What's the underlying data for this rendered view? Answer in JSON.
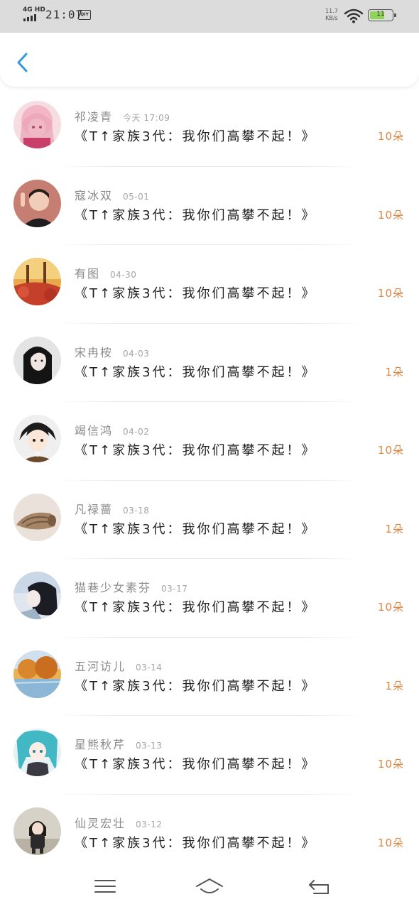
{
  "status_bar": {
    "network": "4G HD",
    "time": "21:07",
    "app_icon_label": "QIY",
    "speed_value": "11.7",
    "speed_unit": "KB/s",
    "battery_label": "11"
  },
  "header": {
    "back_icon": "chevron-left-icon",
    "accent_color": "#2f9be0"
  },
  "list": {
    "count_color": "#e0853e",
    "items": [
      {
        "name": "祁凌青",
        "date": "今天 17:09",
        "title": "《T↑家族3代：我你们高攀不起！》",
        "count": "10朵",
        "avatar": "pink-hair-anime-girl"
      },
      {
        "name": "寇冰双",
        "date": "05-01",
        "title": "《T↑家族3代：我你们高攀不起！》",
        "count": "10朵",
        "avatar": "boy-portrait"
      },
      {
        "name": "有图",
        "date": "04-30",
        "title": "《T↑家族3代：我你们高攀不起！》",
        "count": "10朵",
        "avatar": "autumn-forest"
      },
      {
        "name": "宋冉桉",
        "date": "04-03",
        "title": "《T↑家族3代：我你们高攀不起！》",
        "count": "1朵",
        "avatar": "dark-hair-girl"
      },
      {
        "name": "竭信鸿",
        "date": "04-02",
        "title": "《T↑家族3代：我你们高攀不起！》",
        "count": "10朵",
        "avatar": "anime-boy"
      },
      {
        "name": "凡禄蔷",
        "date": "03-18",
        "title": "《T↑家族3代：我你们高攀不起！》",
        "count": "1朵",
        "avatar": "seashell"
      },
      {
        "name": "猫巷少女素芬",
        "date": "03-17",
        "title": "《T↑家族3代：我你们高攀不起！》",
        "count": "10朵",
        "avatar": "girl-profile"
      },
      {
        "name": "五河访儿",
        "date": "03-14",
        "title": "《T↑家族3代：我你们高攀不起！》",
        "count": "1朵",
        "avatar": "autumn-lake"
      },
      {
        "name": "星熊秋芹",
        "date": "03-13",
        "title": "《T↑家族3代：我你们高攀不起！》",
        "count": "10朵",
        "avatar": "teal-hair-anime"
      },
      {
        "name": "仙灵宏壮",
        "date": "03-12",
        "title": "《T↑家族3代：我你们高攀不起！》",
        "count": "10朵",
        "avatar": "child-photo"
      }
    ]
  },
  "bottom_nav": {
    "items": [
      "menu-icon",
      "home-icon",
      "back-return-icon"
    ]
  }
}
